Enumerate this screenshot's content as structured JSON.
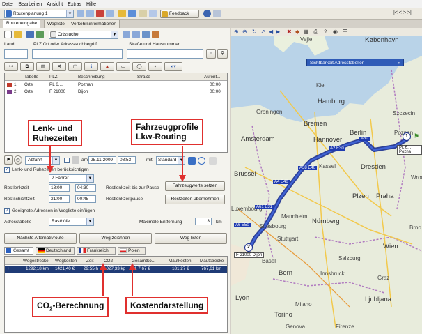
{
  "menu": [
    "Datei",
    "Bearbeiten",
    "Ansicht",
    "Extras",
    "Hilfe"
  ],
  "toolbar": {
    "route_select": "Routenplanung 1",
    "feedback": "Feedback"
  },
  "tabs": [
    "Routeneingabe",
    "Wegliste",
    "Verkehrsinformationen"
  ],
  "search_toolbar": {
    "mode_select": "Ortssuche"
  },
  "address": {
    "land_label": "Land",
    "plz_label": "PLZ Ort oder Adresssuchbegriff",
    "street_label": "Straße und Hausnummer"
  },
  "stops_table": {
    "headers": [
      "Tabelle",
      "PLZ",
      "Beschreibung",
      "Straße",
      "Aufent..."
    ],
    "rows": [
      {
        "num": "1",
        "table": "Orte",
        "plz": "PL 6....",
        "desc": "Poznan",
        "street": "",
        "stay": "00:00"
      },
      {
        "num": "2",
        "table": "Orte",
        "plz": "F 21000",
        "desc": "Dijon",
        "street": "",
        "stay": "00:00"
      }
    ]
  },
  "departure": {
    "mode": "Abfahrt",
    "am_label": "am",
    "date": "25.11.2009",
    "time": "08:53",
    "mit_label": "mit",
    "profile": "Standard"
  },
  "rest": {
    "checkbox_label": "Lenk- und Ruhezeiten berücksichtigen",
    "drivers": "2 Fahrer",
    "restlenkzeit_label": "Restlenkzeit",
    "restlenkzeit_val1": "18:00",
    "restlenkzeit_val2": "04:30",
    "restlenkzeit_pause_label": "Restlenkzeit bis zur Pause",
    "restschicht_label": "Restschichtzeit",
    "restschicht_val1": "21:00",
    "restschicht_val2": "00:45",
    "restlenkzeitpause_label": "Restlenkzeitpause",
    "set_vehicle_btn": "Fahrzeugwerte setzen",
    "reset_btn": "Restzeiten übernehmen"
  },
  "suitable": {
    "checkbox_label": "Geeignete Adressen in Wegliste einfügen",
    "table_label": "Adresstabelle",
    "table_value": "Rasthöfe",
    "max_label": "Maximale Entfernung",
    "max_value": "3",
    "max_unit": "km"
  },
  "actions": [
    "Nächste Alternativroute",
    "Weg zeichnen",
    "Weg listen"
  ],
  "country_tabs": [
    "Gesamt",
    "Deutschland",
    "Frankreich",
    "Polen"
  ],
  "summary": {
    "headers": [
      "Wegestrecke",
      "Wegkosten",
      "Zeit",
      "CO2",
      "Gesamtko...",
      "Mautkosten",
      "Mautstrecke"
    ],
    "values": [
      "1292,18 km",
      "1421,40 €",
      "29:55 h",
      "1027,33 kg",
      "1 7,67 €",
      "181,27 €",
      "767,61 km"
    ]
  },
  "callouts": {
    "lenk": "Lenk- und\nRuhezeiten",
    "fahrzeug": "Fahrzeugprofile\nLkw-Routing",
    "co2_a": "CO",
    "co2_sub": "2",
    "co2_b": "-Berechnung",
    "kosten": "Kostendarstellung"
  },
  "map": {
    "panel_title": "Sichtbarkeit Adresstabellen",
    "labels": [
      "Vejle",
      "København",
      "Kiel",
      "Hamburg",
      "Szczecin",
      "Groningen",
      "Bremen",
      "Amsterdam",
      "Hannover",
      "Berlin",
      "Poznan",
      "Brussel",
      "Kassel",
      "Dresden",
      "Plzen",
      "Praha",
      "Luxembourg",
      "Mannheim",
      "Stuttgart",
      "Nürnberg",
      "Strasbourg",
      "Basel",
      "Salzburg",
      "Wien",
      "Bern",
      "Innsbruck",
      "Lyon",
      "Graz",
      "Ljubljana",
      "Torino",
      "Milano",
      "Genova",
      "Firenze",
      "Wroclaw",
      "Brno"
    ],
    "start_pin": "1",
    "end_pin": "2",
    "start_tag": "PL 6... Pozna",
    "end_tag": "F 21000 Dijon",
    "road_tags": [
      "A30",
      "A2 E30",
      "A38 E40",
      "A4 E40",
      "A61 E31",
      "A6 E50"
    ]
  }
}
